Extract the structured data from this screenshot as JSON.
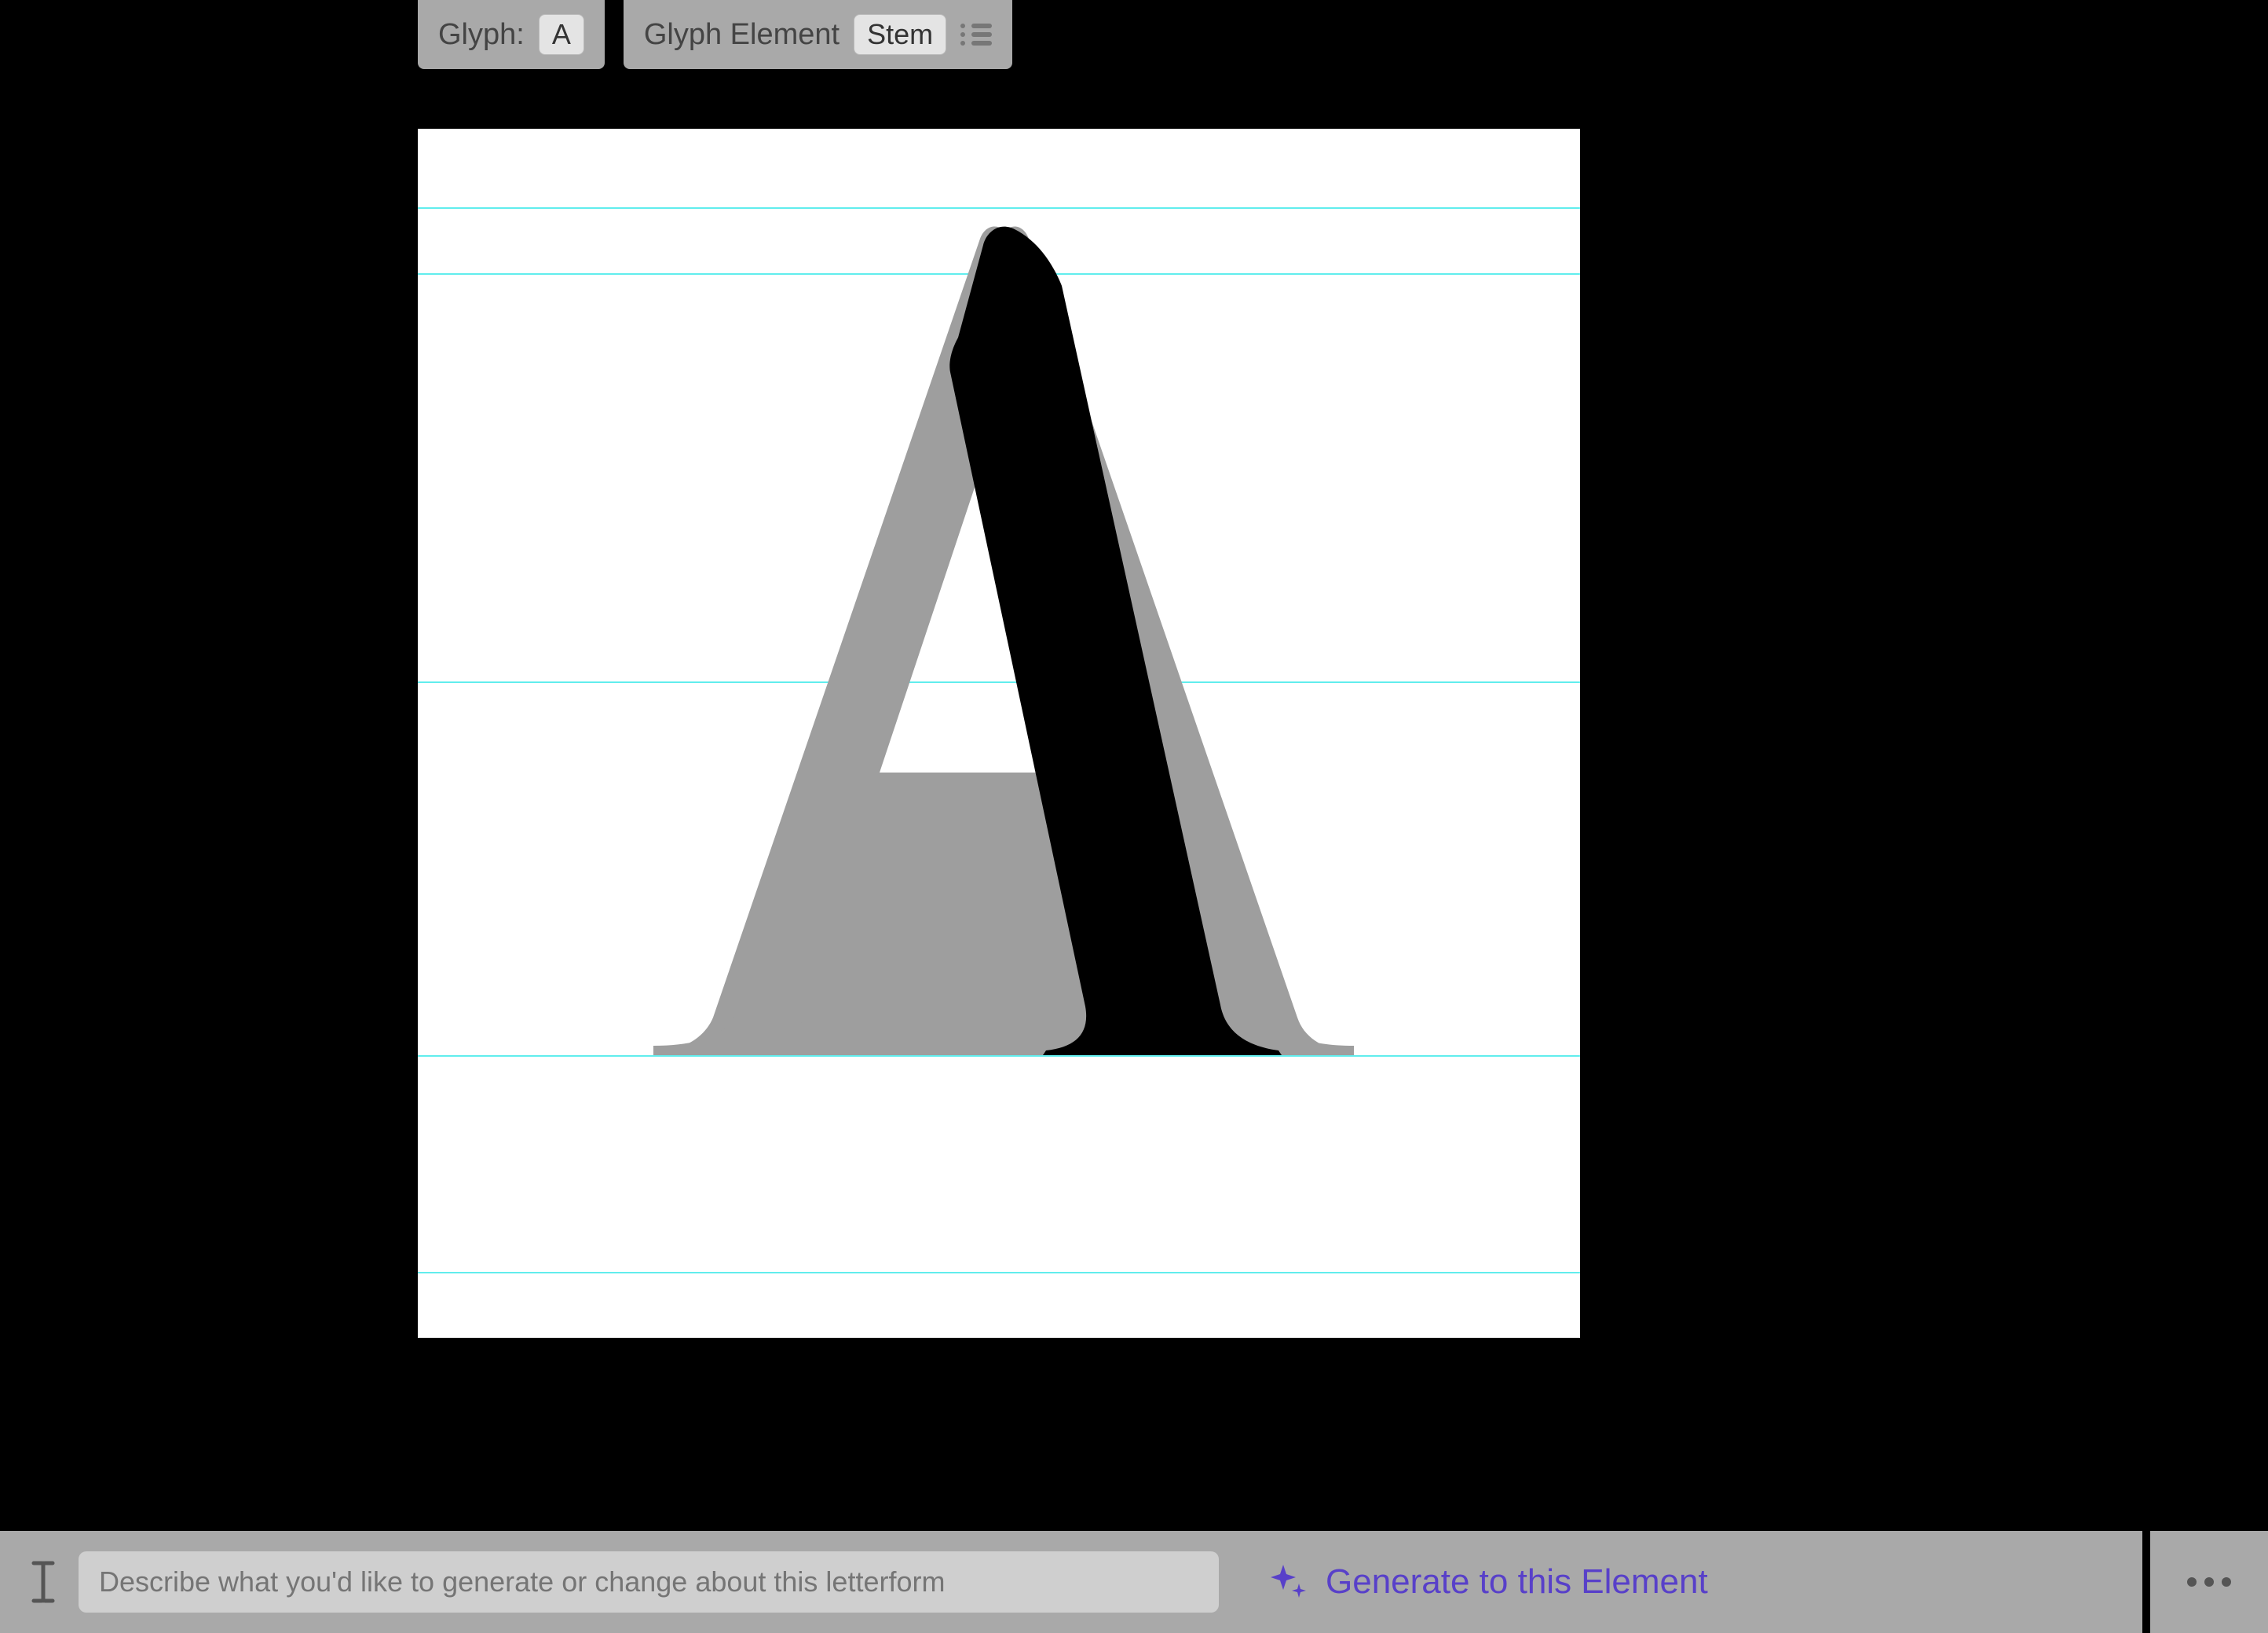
{
  "toolbar": {
    "glyph_label": "Glyph:",
    "glyph_value": "A",
    "element_label": "Glyph Element",
    "element_value": "Stem"
  },
  "canvas": {
    "guidelines": [
      "ascender",
      "cap-height",
      "x-height",
      "baseline",
      "descender"
    ],
    "ghost_glyph": "A",
    "active_element": "Stem"
  },
  "prompt": {
    "placeholder": "Describe what you'd like to generate or change about this letterform"
  },
  "actions": {
    "generate_label": "Generate to this Element"
  },
  "colors": {
    "accent": "#5840c9",
    "guideline": "#45eaea",
    "chrome": "#a9a9a9"
  }
}
